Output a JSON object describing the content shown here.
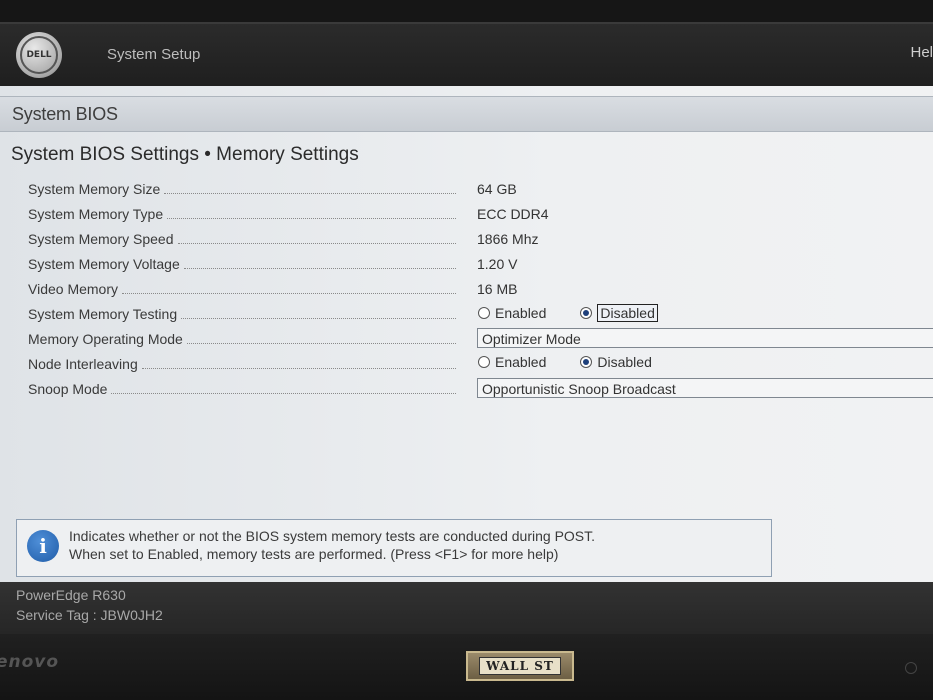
{
  "header": {
    "logo_text": "DELL",
    "app_title": "System Setup",
    "help_label": "Hel"
  },
  "section": {
    "title": "System BIOS",
    "breadcrumb": "System BIOS Settings • Memory Settings"
  },
  "settings": [
    {
      "label": "System Memory Size",
      "value": "64 GB"
    },
    {
      "label": "System Memory Type",
      "value": "ECC DDR4"
    },
    {
      "label": "System Memory Speed",
      "value": "1866 Mhz"
    },
    {
      "label": "System Memory Voltage",
      "value": "1.20 V"
    },
    {
      "label": "Video Memory",
      "value": "16 MB"
    },
    {
      "label": "System Memory Testing",
      "option_enabled": "Enabled",
      "option_disabled": "Disabled",
      "selected": "Disabled"
    },
    {
      "label": "Memory Operating Mode",
      "value": "Optimizer Mode"
    },
    {
      "label": "Node Interleaving",
      "option_enabled": "Enabled",
      "option_disabled": "Disabled",
      "selected": "Disabled"
    },
    {
      "label": "Snoop Mode",
      "value": "Opportunistic Snoop Broadcast"
    }
  ],
  "help": {
    "line1": "Indicates whether or not the BIOS system memory tests are conducted during POST.",
    "line2": "When set to Enabled, memory tests are performed. (Press <F1> for more help)"
  },
  "footer": {
    "model": "PowerEdge R630",
    "service_tag": "Service Tag : JBW0JH2"
  },
  "monitor": {
    "brand": "enovo",
    "badge": "WALL ST"
  },
  "colors": {
    "header_bg": "#232323",
    "pane_bg": "#eceef0",
    "selected_radio": "#1d3f7a",
    "info_icon": "#1f5ca8"
  }
}
